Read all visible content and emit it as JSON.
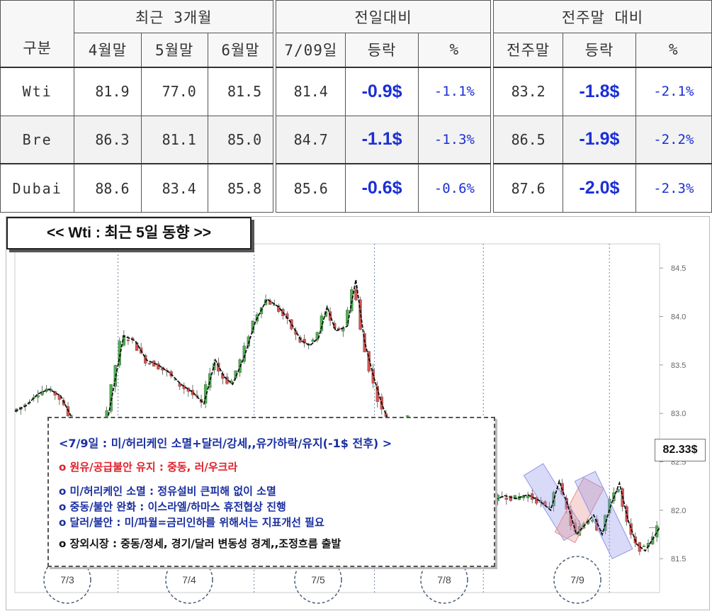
{
  "table": {
    "header_group": {
      "label": "구분",
      "recent": "최근 3개월",
      "prev_day": "전일대비",
      "prev_week": "전주말 대비"
    },
    "header_cols": {
      "apr": "4월말",
      "may": "5월말",
      "jun": "6월말",
      "day": "7/09일",
      "chg1": "등락",
      "pct1": "%",
      "week": "전주말",
      "chg2": "등락",
      "pct2": "%"
    },
    "rows": [
      {
        "name": "Wti",
        "apr": "81.9",
        "may": "77.0",
        "jun": "81.5",
        "day": "81.4",
        "chg1": "-0.9$",
        "pct1": "-1.1%",
        "week": "83.2",
        "chg2": "-1.8$",
        "pct2": "-2.1%"
      },
      {
        "name": "Bre",
        "apr": "86.3",
        "may": "81.1",
        "jun": "85.0",
        "day": "84.7",
        "chg1": "-1.1$",
        "pct1": "-1.3%",
        "week": "86.5",
        "chg2": "-1.9$",
        "pct2": "-2.2%"
      },
      {
        "name": "Dubai",
        "apr": "88.6",
        "may": "83.4",
        "jun": "85.8",
        "day": "85.6",
        "chg1": "-0.6$",
        "pct1": "-0.6%",
        "week": "87.6",
        "chg2": "-2.0$",
        "pct2": "-2.3%"
      }
    ],
    "colors": {
      "change_text": "#1a2fd6",
      "alt_row": "#f2f2f2"
    }
  },
  "chart_data": {
    "type": "candlestick",
    "title": "<< Wti : 최근 5일 동향 >>",
    "last_price_label": "82.33$",
    "ylim": [
      81.15,
      84.75
    ],
    "y_ticks": [
      "84.5",
      "84.0",
      "83.5",
      "83.0",
      "82.5",
      "82.0",
      "81.5"
    ],
    "x_date_labels": [
      "7/3",
      "7/4",
      "7/5",
      "7/8",
      "7/9"
    ],
    "up_color": "#4caf50",
    "down_color": "#d9534f",
    "trend_line_color": "#111111",
    "path": [
      [
        0,
        83.02
      ],
      [
        8,
        83.08
      ],
      [
        16,
        83.2
      ],
      [
        24,
        83.25
      ],
      [
        32,
        83.18
      ],
      [
        40,
        82.95
      ],
      [
        48,
        82.78
      ],
      [
        56,
        82.85
      ],
      [
        62,
        82.72
      ],
      [
        70,
        83.35
      ],
      [
        76,
        83.8
      ],
      [
        84,
        83.75
      ],
      [
        92,
        83.55
      ],
      [
        100,
        83.5
      ],
      [
        108,
        83.42
      ],
      [
        116,
        83.3
      ],
      [
        124,
        83.22
      ],
      [
        132,
        83.1
      ],
      [
        140,
        83.55
      ],
      [
        146,
        83.38
      ],
      [
        152,
        83.3
      ],
      [
        160,
        83.58
      ],
      [
        168,
        83.95
      ],
      [
        176,
        84.18
      ],
      [
        184,
        84.1
      ],
      [
        192,
        83.95
      ],
      [
        200,
        83.75
      ],
      [
        206,
        83.7
      ],
      [
        212,
        83.78
      ],
      [
        218,
        84.1
      ],
      [
        224,
        83.85
      ],
      [
        232,
        83.9
      ],
      [
        238,
        84.38
      ],
      [
        244,
        83.75
      ],
      [
        250,
        83.4
      ],
      [
        256,
        83.1
      ],
      [
        262,
        82.88
      ],
      [
        270,
        82.85
      ],
      [
        276,
        82.95
      ],
      [
        284,
        82.75
      ],
      [
        290,
        82.45
      ],
      [
        296,
        82.2
      ],
      [
        302,
        82.35
      ],
      [
        310,
        82.42
      ],
      [
        318,
        82.48
      ],
      [
        326,
        82.2
      ],
      [
        334,
        82.1
      ],
      [
        342,
        82.15
      ],
      [
        350,
        82.12
      ],
      [
        358,
        82.16
      ],
      [
        366,
        82.1
      ],
      [
        374,
        82.0
      ],
      [
        380,
        82.3
      ],
      [
        386,
        82.05
      ],
      [
        392,
        81.75
      ],
      [
        398,
        81.85
      ],
      [
        404,
        81.95
      ],
      [
        410,
        81.75
      ],
      [
        416,
        82.05
      ],
      [
        422,
        82.28
      ],
      [
        428,
        81.9
      ],
      [
        434,
        81.65
      ],
      [
        440,
        81.58
      ],
      [
        446,
        81.72
      ],
      [
        450,
        81.82
      ]
    ],
    "date_boundaries": [
      72,
      167,
      251,
      327,
      415
    ],
    "bands": [
      {
        "color": "#8f95e8",
        "from": [
          362,
          82.42
        ],
        "to": [
          390,
          81.75
        ]
      },
      {
        "color": "#e89090",
        "from": [
          384,
          81.72
        ],
        "to": [
          404,
          82.28
        ]
      },
      {
        "color": "#8f95e8",
        "from": [
          398,
          82.35
        ],
        "to": [
          424,
          81.55
        ]
      }
    ],
    "callouts": [
      {
        "text": "<7/9일 : 미/허리케인 소멸+달러/강세,,유가하락/유지(-1$ 전후) >",
        "color": "#1a2fa0"
      },
      {
        "text": "o 원유/공급불안 유지 : 중동, 러/우크라",
        "color": "#e0202a"
      },
      {
        "text": "o 미/허리케인 소멸 : 정유설비 큰피해 없이 소멸",
        "color": "#1a2fa0"
      },
      {
        "text": "o 중동/불안 완화 : 이스라엘/하마스 휴전협상 진행",
        "color": "#1a2fa0"
      },
      {
        "text": "o 달러/불안 : 미/파월=금리인하를 위해서는 지표개선 필요",
        "color": "#1a2fa0"
      },
      {
        "text": "o 장외시장 : 중동/정세, 경기/달러 변동성 경계,,조정흐름 출발",
        "color": "#111111"
      }
    ]
  }
}
